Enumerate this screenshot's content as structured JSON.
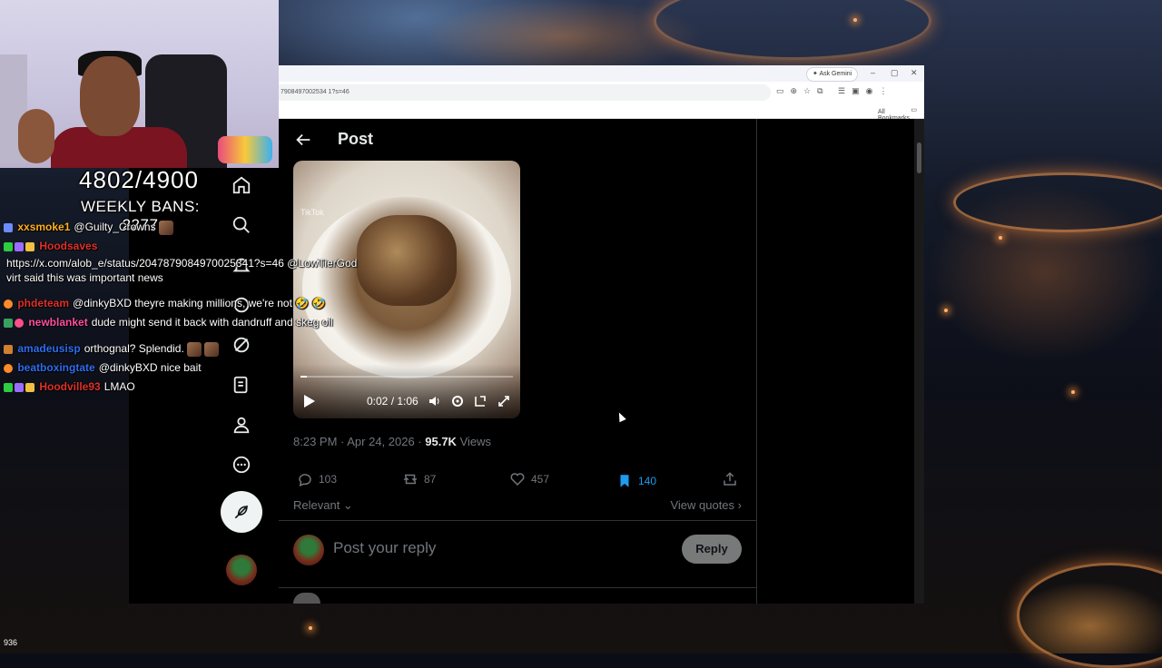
{
  "stream": {
    "counter": "4802/4900",
    "weekly_bans": "WEEKLY BANS: 2277",
    "viewer_count": "936"
  },
  "chat": [
    {
      "user": "xxsmoke1",
      "user_color": "#ffb01f",
      "message": "@Guilty_Crowns"
    },
    {
      "user": "Hoodsaves",
      "user_color": "#e0302a",
      "message": "https://x.com/alob_e/status/2047879084970025341?s=46 @LowTierGod virt said this was important news"
    },
    {
      "user": "phdeteam",
      "user_color": "#e0302a",
      "message": "@dinkyBXD theyre making millions, we're not 🤣 🤣"
    },
    {
      "user": "newblanket",
      "user_color": "#ff4fa3",
      "message": "dude might send it back with dandruff and skeg oil"
    },
    {
      "user": "amadeusisp",
      "user_color": "#2f6df0",
      "message": "orthognal? Splendid."
    },
    {
      "user": "beatboxingtate",
      "user_color": "#2f6df0",
      "message": "@dinkyBXD nice bait"
    },
    {
      "user": "Hoodville93",
      "user_color": "#e0302a",
      "message": "LMAO"
    }
  ],
  "browser": {
    "ask_gemini": "Ask Gemini",
    "url": "7908497002534 1?s=46",
    "all_bookmarks": "All Bookmarks"
  },
  "post": {
    "title": "Post",
    "video": {
      "watermark": "TikTok",
      "current_time": "0:02",
      "duration": "1:06",
      "time_display": "0:02 / 1:06",
      "progress": 0.03
    },
    "timestamp": "8:23 PM · Apr 24, 2026 · ",
    "views_count": "95.7K",
    "views_label": " Views",
    "replies": "103",
    "reposts": "87",
    "likes": "457",
    "bookmarks": "140",
    "sort_label": "Relevant",
    "view_quotes": "View quotes",
    "reply_placeholder": "Post your reply",
    "reply_button": "Reply"
  },
  "colors": {
    "accent_blue": "#1d9bf0",
    "x_text": "#e7e9ea",
    "x_muted": "#71767b"
  }
}
